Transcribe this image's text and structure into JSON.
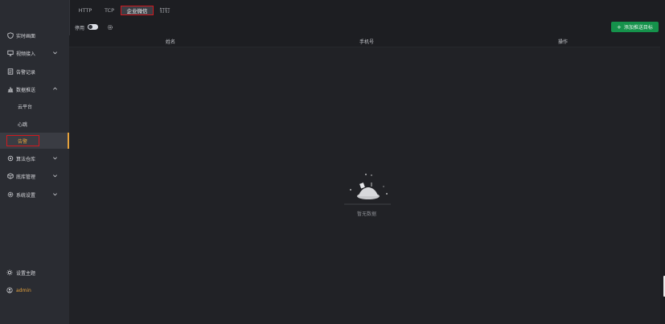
{
  "sidebar": {
    "items": [
      {
        "label": "实时画面",
        "icon": "shield-icon"
      },
      {
        "label": "视频接入",
        "icon": "monitor-icon"
      },
      {
        "label": "告警记录",
        "icon": "document-icon"
      },
      {
        "label": "数据推送",
        "icon": "bar-chart-icon"
      },
      {
        "label": "算法仓库",
        "icon": "cube-icon"
      },
      {
        "label": "底库管理",
        "icon": "database-icon"
      },
      {
        "label": "系统设置",
        "icon": "gear-icon"
      }
    ],
    "sub_items": [
      {
        "label": "云平台"
      },
      {
        "label": "心跳"
      },
      {
        "label": "告警"
      }
    ],
    "bottom": {
      "theme_label": "设置主题",
      "user_label": "admin"
    },
    "accent_color": "#e6a23c"
  },
  "tabs": [
    {
      "label": "HTTP"
    },
    {
      "label": "TCP"
    },
    {
      "label": "企业微信"
    },
    {
      "label": "钉钉"
    }
  ],
  "toolbar": {
    "enable_label": "停用",
    "add_button_label": "添加推送目标",
    "add_button_color": "#15924b"
  },
  "table": {
    "columns": [
      "姓名",
      "手机号",
      "操作"
    ],
    "empty_text": "暂无数据"
  }
}
